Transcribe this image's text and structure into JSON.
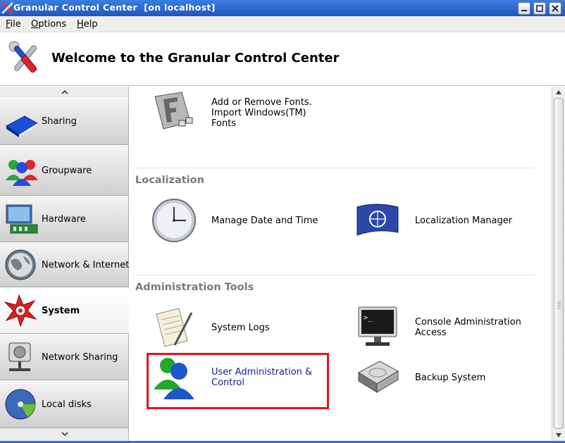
{
  "window": {
    "title": "Granular Control Center  [on localhost]",
    "accent": "#2a64cc"
  },
  "menu": {
    "file": {
      "mnemonic": "F",
      "rest": "ile"
    },
    "options": {
      "mnemonic": "O",
      "rest": "ptions"
    },
    "help": {
      "mnemonic": "H",
      "rest": "elp"
    }
  },
  "header": {
    "title": "Welcome to the Granular Control Center",
    "icon": "tools-icon"
  },
  "sidebar": {
    "items": [
      {
        "label": "Sharing",
        "icon": "sharing-book-icon"
      },
      {
        "label": "Groupware",
        "icon": "groupware-people-icon"
      },
      {
        "label": "Hardware",
        "icon": "hardware-monitor-icon"
      },
      {
        "label": "Network & Internet",
        "icon": "globe-icon"
      },
      {
        "label": "System",
        "icon": "system-gear-icon",
        "selected": true
      },
      {
        "label": "Network Sharing",
        "icon": "network-drive-icon"
      },
      {
        "label": "Local disks",
        "icon": "disk-icon"
      }
    ]
  },
  "content": {
    "fonts_tool": {
      "label_line1": "Add or Remove Fonts.",
      "label_line2": "Import Windows(TM)",
      "label_line3": "Fonts",
      "icon": "font-icon"
    },
    "localization": {
      "title": "Localization",
      "tools": [
        {
          "label": "Manage Date and Time",
          "icon": "clock-icon"
        },
        {
          "label": "Localization Manager",
          "icon": "un-flag-icon"
        }
      ]
    },
    "administration": {
      "title": "Administration Tools",
      "system_logs": {
        "label": "System Logs",
        "icon": "notepad-icon"
      },
      "console": {
        "label_line1": "Console Administration",
        "label_line2": "Access",
        "icon": "terminal-icon"
      },
      "user_admin": {
        "label_line1": "User Administration &",
        "label_line2": "Control",
        "icon": "users-icon"
      },
      "backup": {
        "label": "Backup System",
        "icon": "backup-drive-icon"
      }
    }
  },
  "colors": {
    "highlight_box": "#e0141e",
    "section_title": "#7a7a7a",
    "link_text": "#1c1c8c"
  }
}
